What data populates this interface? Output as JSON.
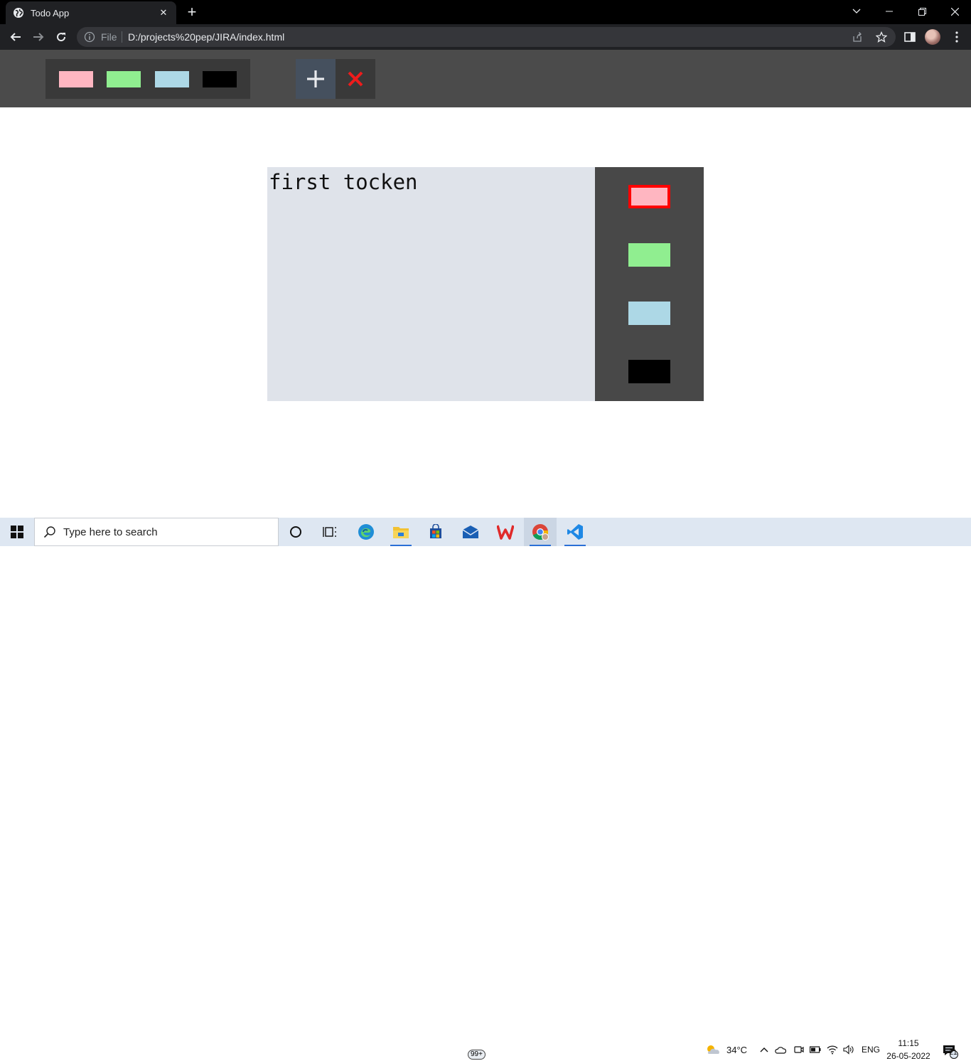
{
  "browser": {
    "tab_title": "Todo App",
    "omnibox_scheme_label": "File",
    "url": "D:/projects%20pep/JIRA/index.html"
  },
  "app": {
    "filters": [
      {
        "name": "pink",
        "color": "#ffb6c1"
      },
      {
        "name": "lightgreen",
        "color": "#90ee90"
      },
      {
        "name": "lightblue",
        "color": "#add8e6"
      },
      {
        "name": "black",
        "color": "#000000"
      }
    ],
    "add_icon": "plus-icon",
    "remove_icon": "x-icon",
    "remove_color": "#ee1c1c"
  },
  "ticket": {
    "text": "first tocken",
    "priority_colors": [
      {
        "name": "pink",
        "color": "#ffb6c1",
        "active": true
      },
      {
        "name": "lightgreen",
        "color": "#90ee90",
        "active": false
      },
      {
        "name": "lightblue",
        "color": "#add8e6",
        "active": false
      },
      {
        "name": "black",
        "color": "#000000",
        "active": false
      }
    ]
  },
  "taskbar": {
    "search_placeholder": "Type here to search",
    "mail_badge": "99+",
    "weather": "34°C",
    "language": "ENG",
    "time": "11:15",
    "date": "26-05-2022",
    "notification_count": "21"
  }
}
